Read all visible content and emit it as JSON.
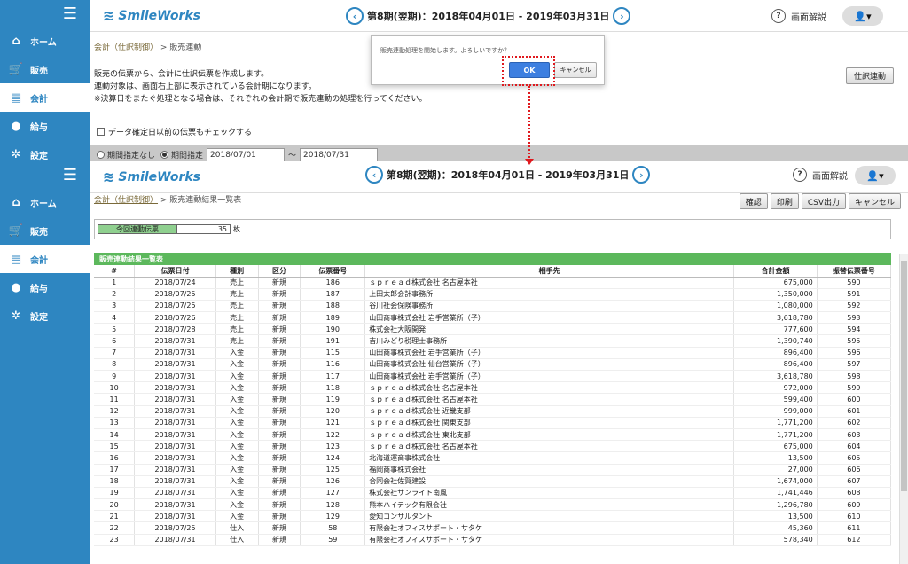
{
  "brand": {
    "logo_text": "SmileWorks"
  },
  "period": {
    "text": "第8期(翌期)：2018年04月01日 - 2019年03月31日",
    "prev": "‹",
    "next": "›"
  },
  "help_label": "画面解説",
  "nav": [
    {
      "label": "ホーム",
      "icon": "home-icon"
    },
    {
      "label": "販売",
      "icon": "cart-icon"
    },
    {
      "label": "会計",
      "icon": "ledger-icon"
    },
    {
      "label": "給与",
      "icon": "moneybag-icon"
    },
    {
      "label": "設定",
      "icon": "gear-icon"
    }
  ],
  "top": {
    "breadcrumb_link": "会計（仕訳制御）",
    "breadcrumb_sep": " > ",
    "breadcrumb_current": "販売連動",
    "desc_1": "販売の伝票から、会計に仕訳伝票を作成します。",
    "desc_2": "連動対象は、画面右上部に表示されている会計期になります。",
    "desc_3": "※決算日をまたぐ処理となる場合は、それぞれの会計期で販売連動の処理を行ってください。",
    "link_button": "仕訳連動",
    "checkbox_label": "データ確定日以前の伝票もチェックする",
    "radio_none": "期間指定なし",
    "radio_range": "期間指定",
    "date_from": "2018/07/01",
    "tilde": "～",
    "date_to": "2018/07/31"
  },
  "dialog": {
    "message": "販売連動処理を開始します。よろしいですか？",
    "ok": "OK",
    "cancel": "キャンセル"
  },
  "bottom": {
    "breadcrumb_link": "会計（仕訳制御）",
    "breadcrumb_sep": " > ",
    "breadcrumb_current": "販売連動結果一覧表",
    "buttons": {
      "confirm": "確認",
      "print": "印刷",
      "csv": "CSV出力",
      "cancel": "キャンセル"
    },
    "count_label": "今回連動伝票",
    "count_value": "35",
    "count_unit": "枚",
    "grid_title": "販売連動結果一覧表",
    "columns": [
      "#",
      "伝票日付",
      "種別",
      "区分",
      "伝票番号",
      "相手先",
      "合計金額",
      "振替伝票番号"
    ],
    "rows": [
      [
        "1",
        "2018/07/24",
        "売上",
        "新規",
        "186",
        "ｓｐｒｅａｄ株式会社 名古屋本社",
        "675,000",
        "590"
      ],
      [
        "2",
        "2018/07/25",
        "売上",
        "新規",
        "187",
        "上田太郎会計事務所",
        "1,350,000",
        "591"
      ],
      [
        "3",
        "2018/07/25",
        "売上",
        "新規",
        "188",
        "谷川社会保険事務所",
        "1,080,000",
        "592"
      ],
      [
        "4",
        "2018/07/26",
        "売上",
        "新規",
        "189",
        "山田商事株式会社 岩手営業所（子）",
        "3,618,780",
        "593"
      ],
      [
        "5",
        "2018/07/28",
        "売上",
        "新規",
        "190",
        "株式会社大阪開発",
        "777,600",
        "594"
      ],
      [
        "6",
        "2018/07/31",
        "売上",
        "新規",
        "191",
        "吉川みどり税理士事務所",
        "1,390,740",
        "595"
      ],
      [
        "7",
        "2018/07/31",
        "入金",
        "新規",
        "115",
        "山田商事株式会社 岩手営業所（子）",
        "896,400",
        "596"
      ],
      [
        "8",
        "2018/07/31",
        "入金",
        "新規",
        "116",
        "山田商事株式会社 仙台営業所（子）",
        "896,400",
        "597"
      ],
      [
        "9",
        "2018/07/31",
        "入金",
        "新規",
        "117",
        "山田商事株式会社 岩手営業所（子）",
        "3,618,780",
        "598"
      ],
      [
        "10",
        "2018/07/31",
        "入金",
        "新規",
        "118",
        "ｓｐｒｅａｄ株式会社 名古屋本社",
        "972,000",
        "599"
      ],
      [
        "11",
        "2018/07/31",
        "入金",
        "新規",
        "119",
        "ｓｐｒｅａｄ株式会社 名古屋本社",
        "599,400",
        "600"
      ],
      [
        "12",
        "2018/07/31",
        "入金",
        "新規",
        "120",
        "ｓｐｒｅａｄ株式会社 近畿支部",
        "999,000",
        "601"
      ],
      [
        "13",
        "2018/07/31",
        "入金",
        "新規",
        "121",
        "ｓｐｒｅａｄ株式会社 関東支部",
        "1,771,200",
        "602"
      ],
      [
        "14",
        "2018/07/31",
        "入金",
        "新規",
        "122",
        "ｓｐｒｅａｄ株式会社 東北支部",
        "1,771,200",
        "603"
      ],
      [
        "15",
        "2018/07/31",
        "入金",
        "新規",
        "123",
        "ｓｐｒｅａｄ株式会社 名古屋本社",
        "675,000",
        "604"
      ],
      [
        "16",
        "2018/07/31",
        "入金",
        "新規",
        "124",
        "北海道運商事株式会社",
        "13,500",
        "605"
      ],
      [
        "17",
        "2018/07/31",
        "入金",
        "新規",
        "125",
        "福岡商事株式会社",
        "27,000",
        "606"
      ],
      [
        "18",
        "2018/07/31",
        "入金",
        "新規",
        "126",
        "合同会社佐賀建設",
        "1,674,000",
        "607"
      ],
      [
        "19",
        "2018/07/31",
        "入金",
        "新規",
        "127",
        "株式会社サンライト南風",
        "1,741,446",
        "608"
      ],
      [
        "20",
        "2018/07/31",
        "入金",
        "新規",
        "128",
        "熊本ハイテック有限会社",
        "1,296,780",
        "609"
      ],
      [
        "21",
        "2018/07/31",
        "入金",
        "新規",
        "129",
        "愛知コンサルタント",
        "13,500",
        "610"
      ],
      [
        "22",
        "2018/07/25",
        "仕入",
        "新規",
        "58",
        "有限会社オフィスサポート・サタケ",
        "45,360",
        "611"
      ],
      [
        "23",
        "2018/07/31",
        "仕入",
        "新規",
        "59",
        "有限会社オフィスサポート・サタケ",
        "578,340",
        "612"
      ]
    ]
  }
}
